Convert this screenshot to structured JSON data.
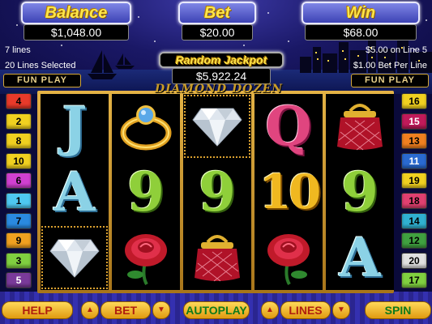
{
  "meters": {
    "balance": {
      "title": "Balance",
      "value": "$1,048.00"
    },
    "bet": {
      "title": "Bet",
      "value": "$20.00"
    },
    "win": {
      "title": "Win",
      "value": "$68.00"
    },
    "jackpot": {
      "title": "Random Jackpot",
      "value": "$5,922.24"
    }
  },
  "info": {
    "lines_won": "7 lines",
    "lines_selected": "20 Lines Selected",
    "line_win": "$5.00 on Line 5",
    "bet_per_line": "$1.00 Bet Per Line"
  },
  "fun_play_left": "FUN PLAY",
  "fun_play_right": "FUN PLAY",
  "game_title": "DIAMOND DOZEN",
  "reels": [
    [
      {
        "symbol": "J"
      },
      {
        "symbol": "A"
      },
      {
        "symbol": "diamond"
      }
    ],
    [
      {
        "symbol": "ring"
      },
      {
        "symbol": "9"
      },
      {
        "symbol": "rose"
      }
    ],
    [
      {
        "symbol": "diamond"
      },
      {
        "symbol": "9"
      },
      {
        "symbol": "purse"
      }
    ],
    [
      {
        "symbol": "Q"
      },
      {
        "symbol": "10"
      },
      {
        "symbol": "rose"
      }
    ],
    [
      {
        "symbol": "purse"
      },
      {
        "symbol": "9"
      },
      {
        "symbol": "A"
      }
    ]
  ],
  "left_lines": [
    {
      "num": "4",
      "color": "#e83a2a"
    },
    {
      "num": "2",
      "color": "#f0d020"
    },
    {
      "num": "8",
      "color": "#f0d020"
    },
    {
      "num": "10",
      "color": "#f0d020"
    },
    {
      "num": "6",
      "color": "#d040d0"
    },
    {
      "num": "1",
      "color": "#4ec8f0"
    },
    {
      "num": "7",
      "color": "#2a8ae0"
    },
    {
      "num": "9",
      "color": "#f0a020"
    },
    {
      "num": "3",
      "color": "#80d040"
    },
    {
      "num": "5",
      "color": "#7a3a9a"
    }
  ],
  "right_lines": [
    {
      "num": "16",
      "color": "#f0d020"
    },
    {
      "num": "15",
      "color": "#c01a5a"
    },
    {
      "num": "13",
      "color": "#f08020"
    },
    {
      "num": "11",
      "color": "#2a6ad0"
    },
    {
      "num": "19",
      "color": "#f0d020"
    },
    {
      "num": "18",
      "color": "#e04070"
    },
    {
      "num": "14",
      "color": "#30b0d0"
    },
    {
      "num": "12",
      "color": "#40a040"
    },
    {
      "num": "20",
      "color": "#e0e0e0"
    },
    {
      "num": "17",
      "color": "#80d040"
    }
  ],
  "buttons": {
    "help": "HELP",
    "bet": "BET",
    "autoplay": "AUTOPLAY",
    "lines": "LINES",
    "spin": "SPIN"
  }
}
